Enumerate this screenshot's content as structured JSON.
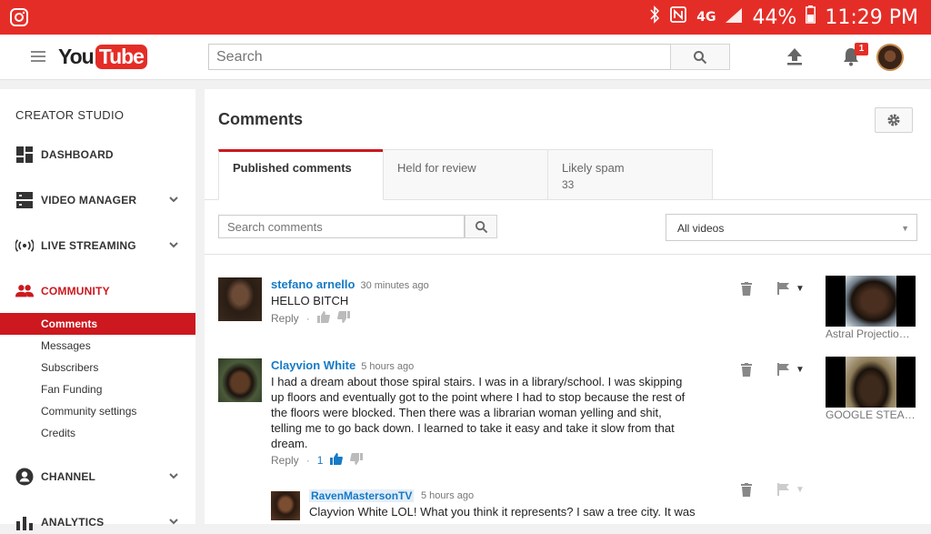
{
  "statusbar": {
    "battery": "44%",
    "time": "11:29 PM",
    "network": "4G",
    "app_icon": "instagram-icon"
  },
  "topbar": {
    "logo_you": "You",
    "logo_tube": "Tube",
    "search_placeholder": "Search",
    "notification_count": "1"
  },
  "sidebar": {
    "title": "CREATOR STUDIO",
    "items": [
      {
        "label": "DASHBOARD",
        "icon": "dashboard-icon"
      },
      {
        "label": "VIDEO MANAGER",
        "icon": "video-manager-icon"
      },
      {
        "label": "LIVE STREAMING",
        "icon": "live-streaming-icon"
      },
      {
        "label": "COMMUNITY",
        "icon": "community-icon"
      },
      {
        "label": "CHANNEL",
        "icon": "channel-icon"
      },
      {
        "label": "ANALYTICS",
        "icon": "analytics-icon"
      }
    ],
    "community_sub": [
      "Comments",
      "Messages",
      "Subscribers",
      "Fan Funding",
      "Community settings",
      "Credits"
    ]
  },
  "main": {
    "title": "Comments",
    "tabs": [
      {
        "label": "Published comments",
        "count": ""
      },
      {
        "label": "Held for review",
        "count": ""
      },
      {
        "label": "Likely spam",
        "count": "33"
      }
    ],
    "search_placeholder": "Search comments",
    "filter_value": "All videos"
  },
  "comments": [
    {
      "author": "stefano arnello",
      "time": "30 minutes ago",
      "text": "HELLO BITCH",
      "reply_label": "Reply",
      "likes": "",
      "video_title": "Astral Projectio…"
    },
    {
      "author": "Clayvion White",
      "time": "5 hours ago",
      "text": "I had a dream about those spiral stairs. I was in a library/school. I was skipping up floors and eventually got to the point where I had to stop because the rest of the floors were blocked. Then there was a librarian woman yelling and shit, telling me to go back down. I learned to take it easy and take it slow from that dream.",
      "reply_label": "Reply",
      "likes": "1",
      "video_title": "GOOGLE STEA…"
    },
    {
      "author": "RavenMastersonTV",
      "time": "5 hours ago",
      "text": "Clayvion White LOL! What you think it represents? I saw a tree city. It was"
    }
  ],
  "colors": {
    "brand_red": "#e52d27",
    "active_red": "#cc181e",
    "link_blue": "#167ac6"
  }
}
